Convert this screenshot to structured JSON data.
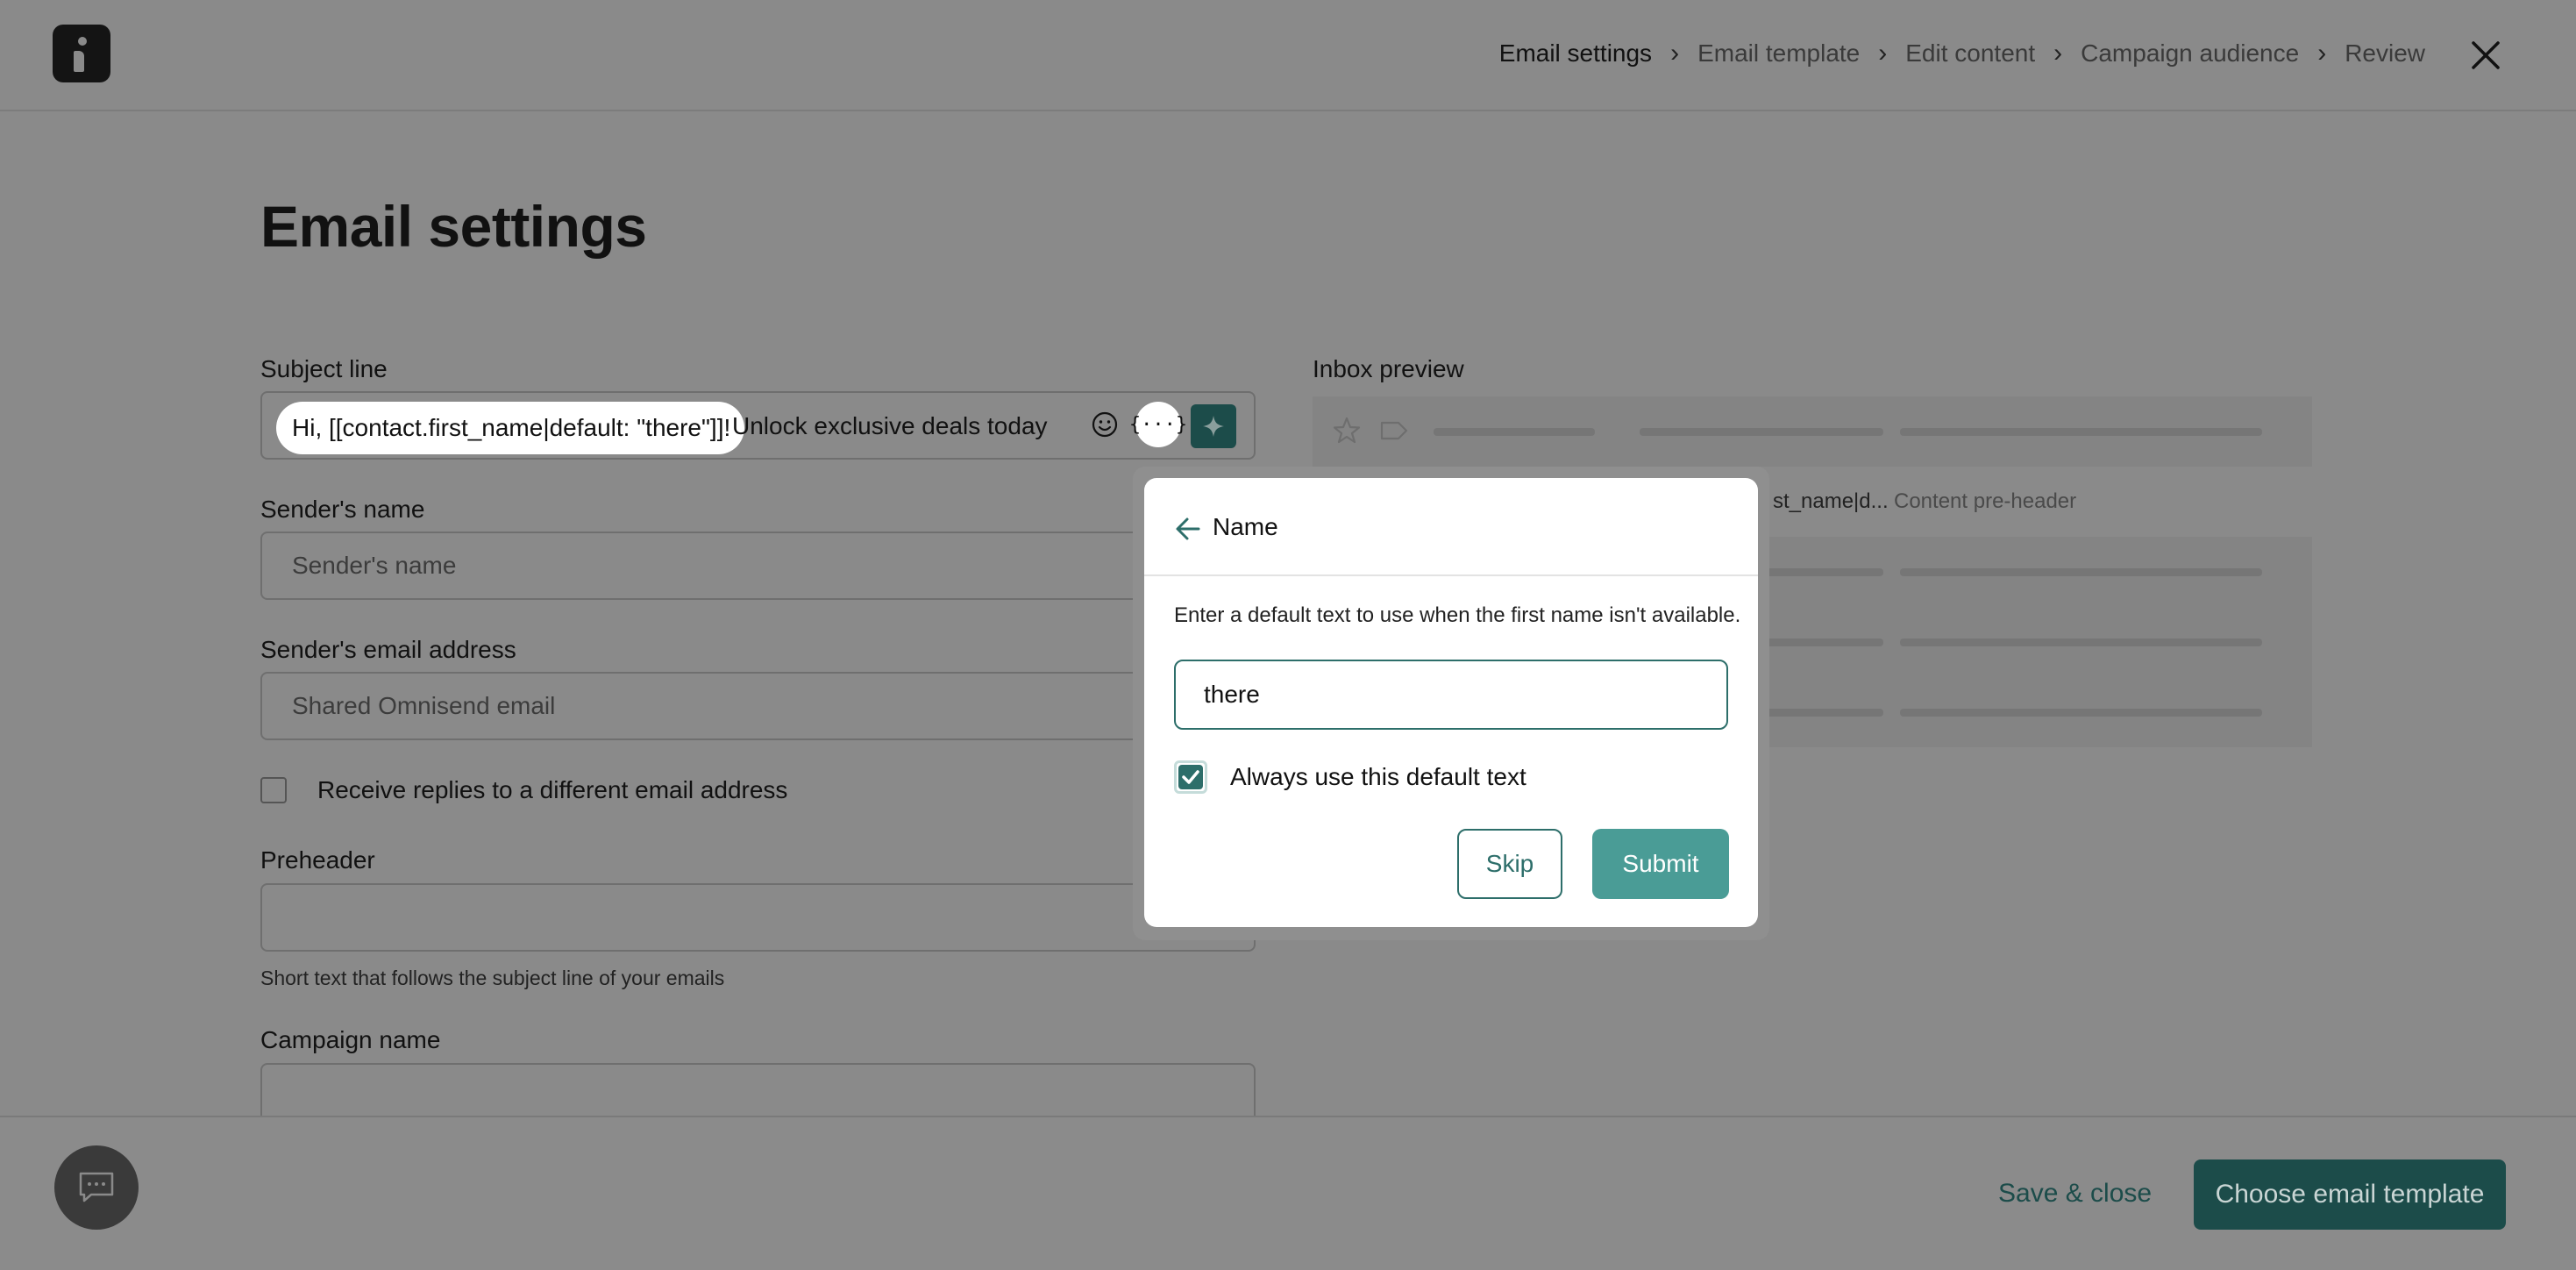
{
  "header": {
    "steps": [
      {
        "label": "Email settings"
      },
      {
        "label": "Email template"
      },
      {
        "label": "Edit content"
      },
      {
        "label": "Campaign audience"
      },
      {
        "label": "Review"
      }
    ]
  },
  "page": {
    "title": "Email settings",
    "subject": {
      "label": "Subject line",
      "variable_text": "Hi, [[contact.first_name|default: \"there\"]]!",
      "rest_text": " Unlock exclusive deals today",
      "variable_button": "{···}"
    },
    "sender_name": {
      "label": "Sender's name",
      "placeholder": "Sender's name"
    },
    "sender_email": {
      "label": "Sender's email address",
      "value": "Shared Omnisend email"
    },
    "replies_checkbox": {
      "label": "Receive replies to a different email address",
      "checked": false
    },
    "preheader": {
      "label": "Preheader",
      "help": "Short text that follows the subject line of your emails"
    },
    "campaign_name": {
      "label": "Campaign name"
    }
  },
  "inbox_preview": {
    "label": "Inbox preview",
    "subject_snippet": "st_name|d...",
    "preheader_snippet": "Content pre-header"
  },
  "popover": {
    "title": "Name",
    "description": "Enter a default text to use when the first name isn't available.",
    "input_value": "there",
    "checkbox_label": "Always use this default text",
    "checkbox_checked": true,
    "skip_label": "Skip",
    "submit_label": "Submit"
  },
  "footer": {
    "save_label": "Save & close",
    "primary_label": "Choose email template"
  },
  "colors": {
    "accent": "#2d6e6a",
    "submit": "#4a9c96",
    "primary_dark": "#1c4c4a"
  }
}
